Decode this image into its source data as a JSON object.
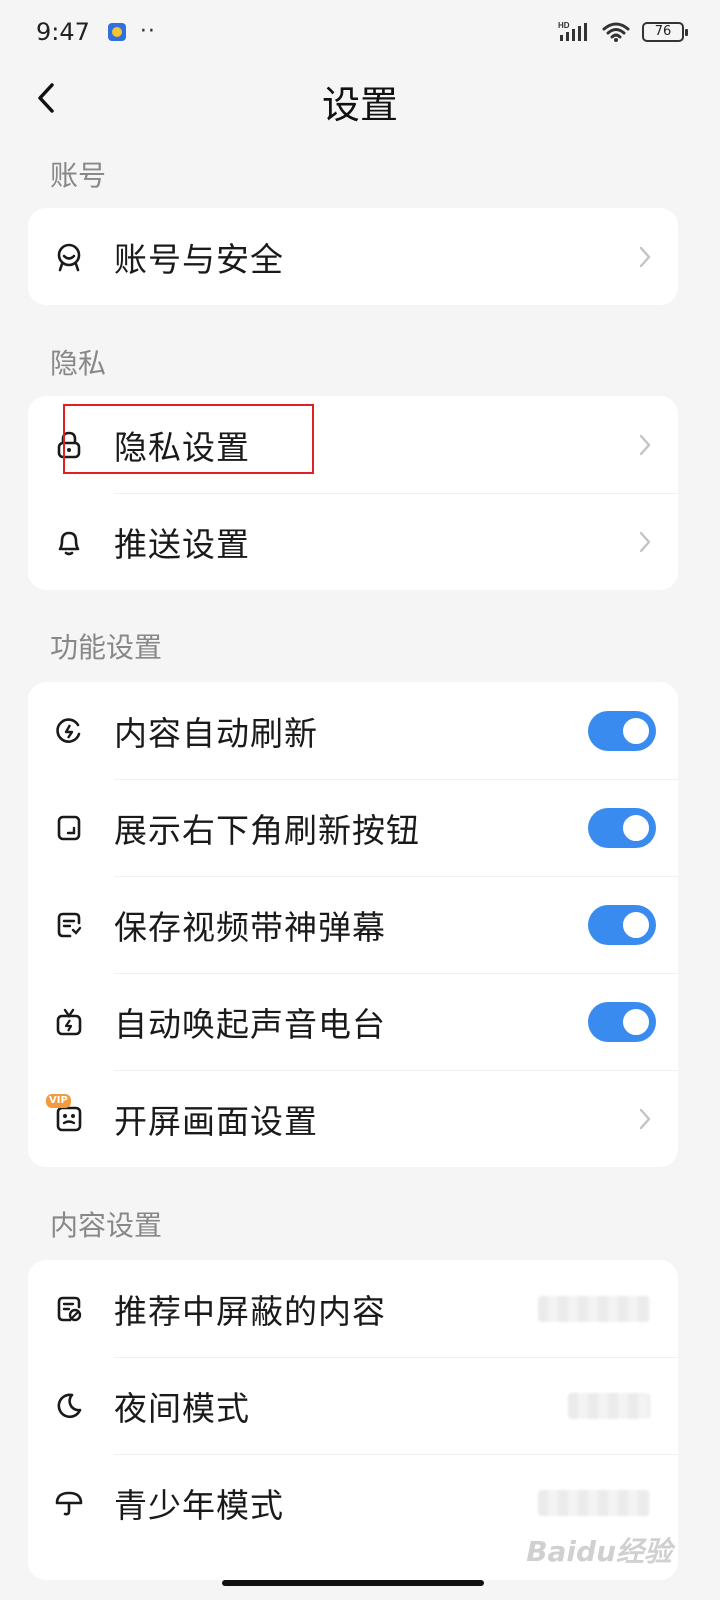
{
  "status_bar": {
    "time": "9:47",
    "dots": "··",
    "battery": "76",
    "hd_label": "HD"
  },
  "header": {
    "title": "设置"
  },
  "sections": {
    "account": {
      "title": "账号",
      "items": [
        {
          "label": "账号与安全",
          "icon": "account-security-icon",
          "control": "chevron"
        }
      ]
    },
    "privacy": {
      "title": "隐私",
      "items": [
        {
          "label": "隐私设置",
          "icon": "lock-icon",
          "control": "chevron"
        },
        {
          "label": "推送设置",
          "icon": "bell-icon",
          "control": "chevron"
        }
      ]
    },
    "features": {
      "title": "功能设置",
      "items": [
        {
          "label": "内容自动刷新",
          "icon": "refresh-icon",
          "control": "toggle",
          "on": true
        },
        {
          "label": "展示右下角刷新按钮",
          "icon": "corner-button-icon",
          "control": "toggle",
          "on": true
        },
        {
          "label": "保存视频带神弹幕",
          "icon": "danmaku-icon",
          "control": "toggle",
          "on": true
        },
        {
          "label": "自动唤起声音电台",
          "icon": "radio-icon",
          "control": "toggle",
          "on": true
        },
        {
          "label": "开屏画面设置",
          "icon": "splash-image-icon",
          "control": "chevron",
          "badge": "VIP"
        }
      ]
    },
    "content": {
      "title": "内容设置",
      "items": [
        {
          "label": "推荐中屏蔽的内容",
          "icon": "blocked-content-icon",
          "control": "blurred-value"
        },
        {
          "label": "夜间模式",
          "icon": "moon-icon",
          "control": "blurred-value"
        },
        {
          "label": "青少年模式",
          "icon": "umbrella-icon",
          "control": "blurred-value"
        }
      ]
    }
  },
  "watermark": "Baidu经验",
  "colors": {
    "accent": "#3a8bf0",
    "background": "#f5f5f5",
    "card": "#ffffff",
    "highlight": "#e02020"
  }
}
